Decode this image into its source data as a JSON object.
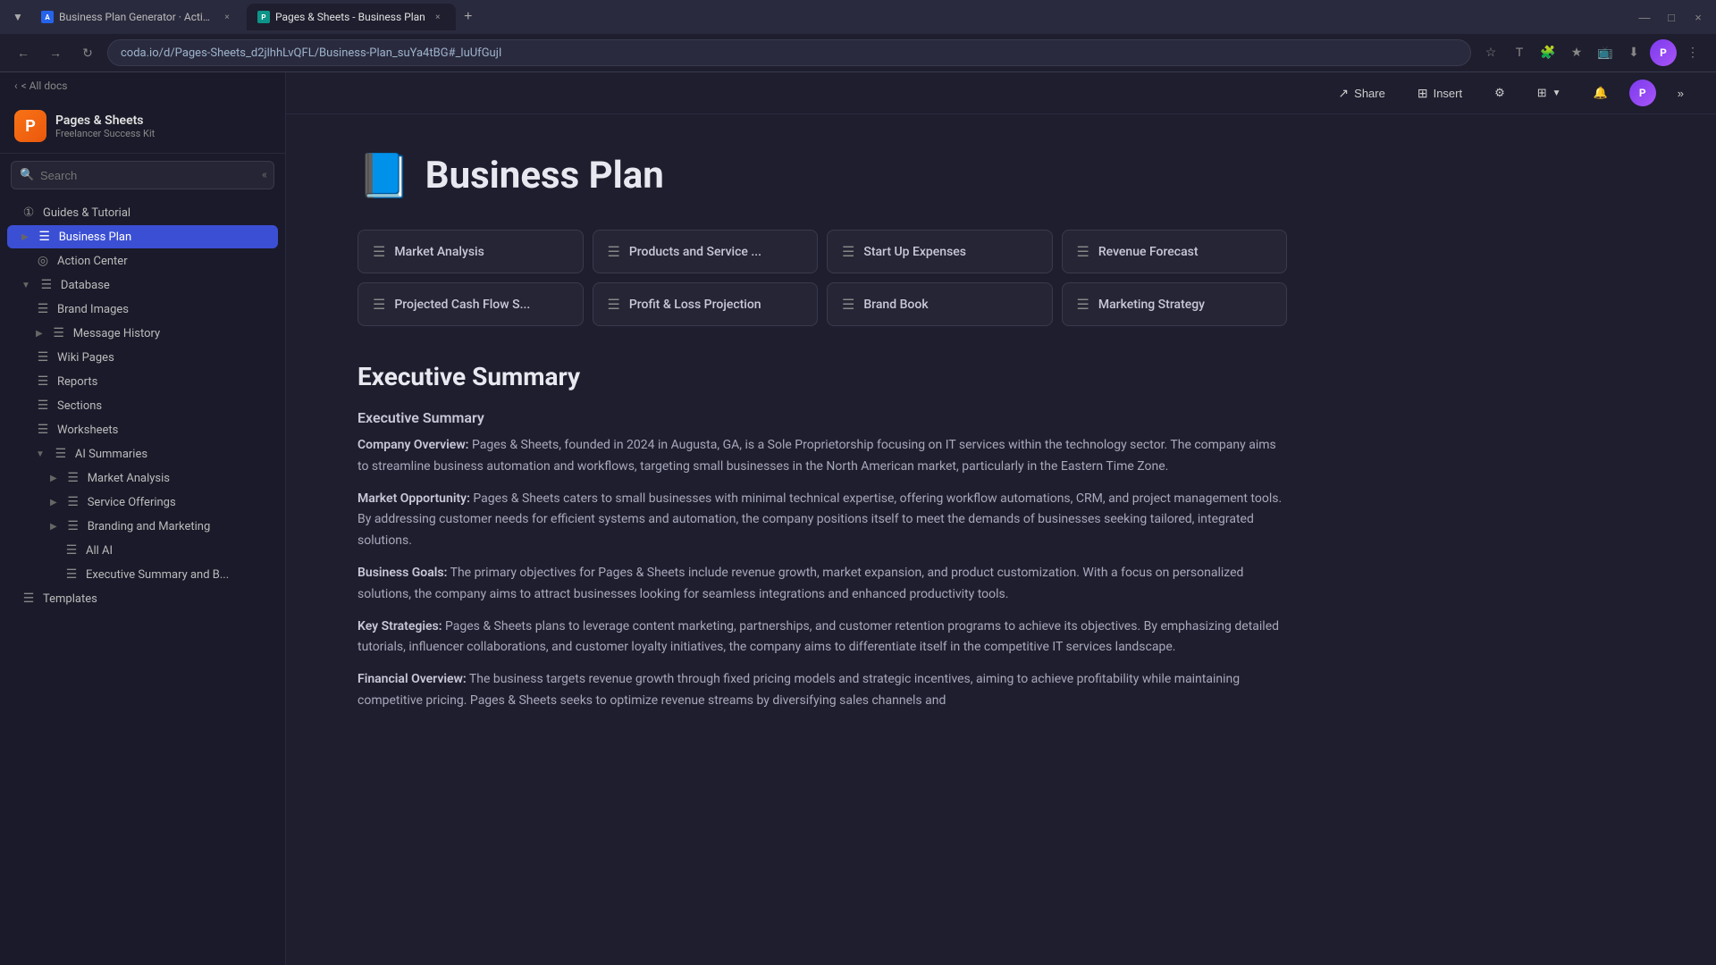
{
  "browser": {
    "tabs": [
      {
        "id": "tab1",
        "label": "Business Plan Generator · Actio...",
        "favicon_color": "#2563eb",
        "favicon_text": "A",
        "active": false,
        "close_label": "×"
      },
      {
        "id": "tab2",
        "label": "Pages & Sheets - Business Plan",
        "favicon_color": "#0d9488",
        "favicon_text": "P",
        "active": true,
        "close_label": "×"
      }
    ],
    "new_tab_label": "+",
    "url": "coda.io/d/Pages-Sheets_d2jlhhLvQFL/Business-Plan_suYa4tBG#_luUfGujI",
    "nav": {
      "back": "←",
      "forward": "→",
      "refresh": "↻"
    },
    "window_buttons": {
      "minimize": "—",
      "maximize": "□",
      "close": "×"
    },
    "actions": {
      "bookmark": "☆",
      "extensions": "🧩",
      "download": "⬇",
      "menu": "⋮",
      "star": "★",
      "share": "➦",
      "translate": "T"
    }
  },
  "top_bar": {
    "share_label": "Share",
    "insert_label": "Insert",
    "settings_label": "⚙",
    "layout_label": "⊞",
    "bell_label": "🔔",
    "collapse_label": "»"
  },
  "sidebar": {
    "back_label": "< All docs",
    "workspace_name": "Pages & Sheets",
    "workspace_subtitle": "Freelancer Success Kit",
    "search_placeholder": "Search",
    "collapse_btn": "«",
    "nav_items": [
      {
        "id": "guides",
        "label": "Guides & Tutorial",
        "icon": "①",
        "indent": 0,
        "expandable": false,
        "active": false
      },
      {
        "id": "business-plan",
        "label": "Business Plan",
        "icon": "☰",
        "indent": 0,
        "expandable": true,
        "active": true
      },
      {
        "id": "action-center",
        "label": "Action Center",
        "icon": "◎",
        "indent": 1,
        "expandable": false,
        "active": false
      },
      {
        "id": "database",
        "label": "Database",
        "icon": "☰",
        "indent": 0,
        "expandable": true,
        "active": false,
        "expanded": true
      },
      {
        "id": "brand-images",
        "label": "Brand Images",
        "icon": "☰",
        "indent": 1,
        "expandable": false,
        "active": false
      },
      {
        "id": "message-history",
        "label": "Message History",
        "icon": "☰",
        "indent": 1,
        "expandable": true,
        "active": false
      },
      {
        "id": "wiki-pages",
        "label": "Wiki Pages",
        "icon": "☰",
        "indent": 1,
        "expandable": false,
        "active": false
      },
      {
        "id": "reports",
        "label": "Reports",
        "icon": "☰",
        "indent": 1,
        "expandable": false,
        "active": false
      },
      {
        "id": "sections",
        "label": "Sections",
        "icon": "☰",
        "indent": 1,
        "expandable": false,
        "active": false
      },
      {
        "id": "worksheets",
        "label": "Worksheets",
        "icon": "☰",
        "indent": 1,
        "expandable": false,
        "active": false
      },
      {
        "id": "ai-summaries",
        "label": "AI Summaries",
        "icon": "☰",
        "indent": 1,
        "expandable": true,
        "active": false,
        "expanded": true
      },
      {
        "id": "market-analysis",
        "label": "Market Analysis",
        "icon": "☰",
        "indent": 2,
        "expandable": true,
        "active": false
      },
      {
        "id": "service-offerings",
        "label": "Service Offerings",
        "icon": "☰",
        "indent": 2,
        "expandable": true,
        "active": false
      },
      {
        "id": "branding-marketing",
        "label": "Branding and Marketing",
        "icon": "☰",
        "indent": 2,
        "expandable": true,
        "active": false
      },
      {
        "id": "all-ai",
        "label": "All AI",
        "icon": "☰",
        "indent": 3,
        "expandable": false,
        "active": false
      },
      {
        "id": "executive-summary-b",
        "label": "Executive Summary and B...",
        "icon": "☰",
        "indent": 3,
        "expandable": false,
        "active": false
      },
      {
        "id": "templates",
        "label": "Templates",
        "icon": "☰",
        "indent": 0,
        "expandable": false,
        "active": false
      }
    ]
  },
  "page": {
    "emoji": "📘",
    "title": "Business Plan",
    "cards": [
      {
        "id": "market-analysis",
        "icon": "☰",
        "label": "Market Analysis"
      },
      {
        "id": "products-service",
        "icon": "☰",
        "label": "Products and Service ..."
      },
      {
        "id": "startup-expenses",
        "icon": "☰",
        "label": "Start Up Expenses"
      },
      {
        "id": "revenue-forecast",
        "icon": "☰",
        "label": "Revenue Forecast"
      },
      {
        "id": "cash-flow",
        "icon": "☰",
        "label": "Projected Cash Flow S..."
      },
      {
        "id": "profit-loss",
        "icon": "☰",
        "label": "Profit & Loss Projection"
      },
      {
        "id": "brand-book",
        "icon": "☰",
        "label": "Brand Book"
      },
      {
        "id": "marketing-strategy",
        "icon": "☰",
        "label": "Marketing Strategy"
      }
    ],
    "section_heading": "Executive Summary",
    "subsection_label": "Executive Summary",
    "paragraphs": [
      {
        "label": "Company Overview:",
        "text": " Pages & Sheets, founded in 2024 in Augusta, GA, is a Sole Proprietorship focusing on IT services within the technology sector. The company aims to streamline business automation and workflows, targeting small businesses in the North American market, particularly in the Eastern Time Zone."
      },
      {
        "label": "Market Opportunity:",
        "text": " Pages & Sheets caters to small businesses with minimal technical expertise, offering workflow automations, CRM, and project management tools. By addressing customer needs for efficient systems and automation, the company positions itself to meet the demands of businesses seeking tailored, integrated solutions."
      },
      {
        "label": "Business Goals:",
        "text": " The primary objectives for Pages & Sheets include revenue growth, market expansion, and product customization. With a focus on personalized solutions, the company aims to attract businesses looking for seamless integrations and enhanced productivity tools."
      },
      {
        "label": "Key Strategies:",
        "text": " Pages & Sheets plans to leverage content marketing, partnerships, and customer retention programs to achieve its objectives. By emphasizing detailed tutorials, influencer collaborations, and customer loyalty initiatives, the company aims to differentiate itself in the competitive IT services landscape."
      },
      {
        "label": "Financial Overview:",
        "text": " The business targets revenue growth through fixed pricing models and strategic incentives, aiming to achieve profitability while maintaining competitive pricing. Pages & Sheets seeks to optimize revenue streams by diversifying sales channels and"
      }
    ]
  }
}
